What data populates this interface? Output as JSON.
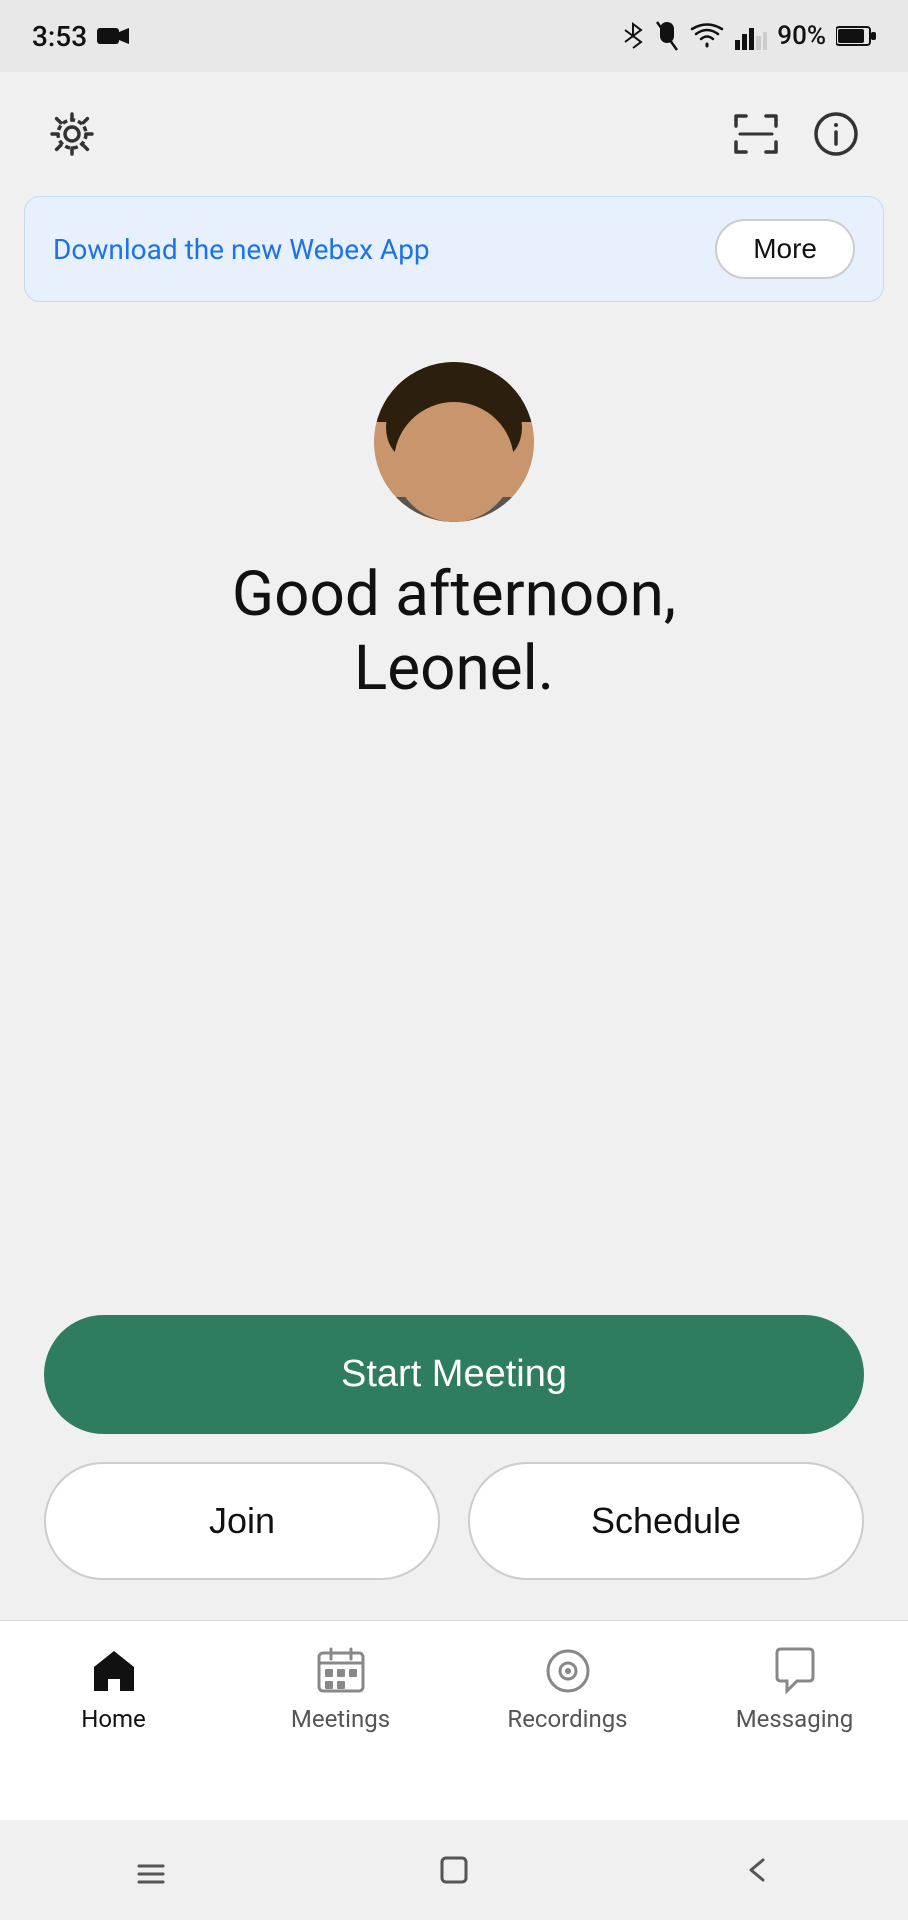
{
  "statusBar": {
    "time": "3:53",
    "battery": "90%"
  },
  "topBar": {
    "settingsIcon": "gear-icon",
    "scanIcon": "scan-icon",
    "infoIcon": "info-icon"
  },
  "banner": {
    "text": "Download the new Webex App",
    "buttonLabel": "More"
  },
  "greeting": {
    "salutation": "Good afternoon,",
    "name": "Leonel."
  },
  "actions": {
    "startMeeting": "Start Meeting",
    "join": "Join",
    "schedule": "Schedule"
  },
  "bottomNav": {
    "items": [
      {
        "id": "home",
        "label": "Home",
        "active": true
      },
      {
        "id": "meetings",
        "label": "Meetings",
        "active": false
      },
      {
        "id": "recordings",
        "label": "Recordings",
        "active": false
      },
      {
        "id": "messaging",
        "label": "Messaging",
        "active": false
      }
    ]
  },
  "colors": {
    "startBtn": "#2e7d5e",
    "bannerBg": "#e8f0fe",
    "bannerText": "#1a73e8"
  }
}
